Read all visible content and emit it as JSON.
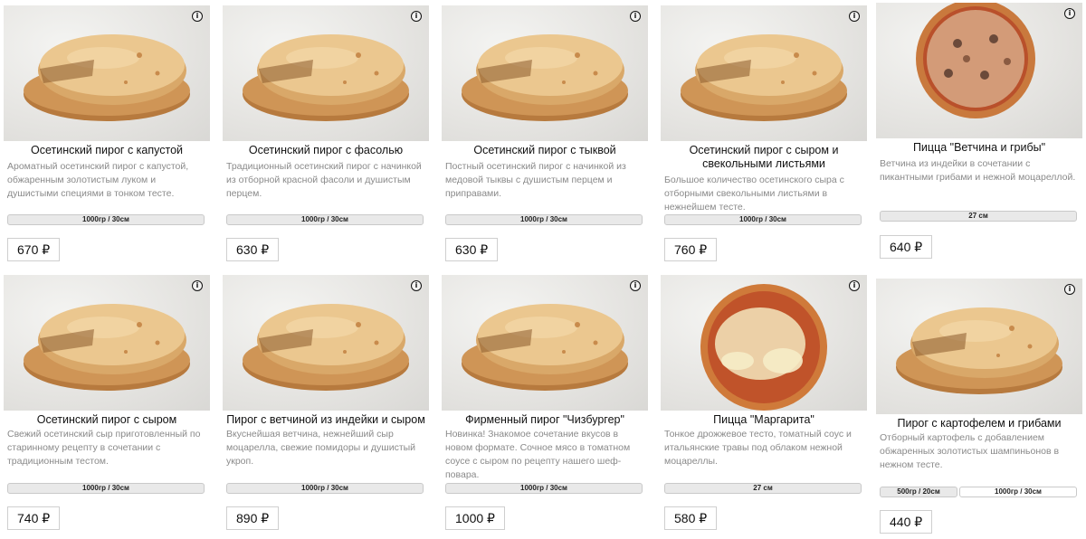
{
  "info_icon": "info-icon",
  "currency": "₽",
  "products": [
    {
      "title": "Осетинский пирог с капустой",
      "description": "Ароматный осетинский пирог с капустой, обжаренным золотистым луком и душистыми специями в тонком тесте.",
      "sizes": [
        "1000гр / 30см"
      ],
      "price": "670 ₽",
      "image": "pie-cabbage"
    },
    {
      "title": "Осетинский пирог с фасолью",
      "description": "Традиционный осетинский пирог с начинкой из отборной красной фасоли и душистым перцем.",
      "sizes": [
        "1000гр / 30см"
      ],
      "price": "630 ₽",
      "image": "pie-beans"
    },
    {
      "title": "Осетинский пирог с тыквой",
      "description": "Постный осетинский пирог с начинкой из медовой тыквы с душистым перцем и приправами.",
      "sizes": [
        "1000гр / 30см"
      ],
      "price": "630 ₽",
      "image": "pie-pumpkin"
    },
    {
      "title": "Осетинский пирог с сыром и свекольными листьями",
      "description": "Большое количество осетинского сыра с отборными свекольными листьями в нежнейшем тесте.",
      "sizes": [
        "1000гр / 30см"
      ],
      "price": "760 ₽",
      "image": "pie-cheese-beet-leaves"
    },
    {
      "title": "Пицца \"Ветчина и грибы\"",
      "description": "Ветчина из индейки в сочетании с пикантными грибами и нежной моцареллой.",
      "sizes": [
        "27 см"
      ],
      "price": "640 ₽",
      "image": "pizza-ham-mushrooms"
    },
    {
      "title": "Осетинский пирог с сыром",
      "description": "Свежий осетинский сыр приготовленный по старинному рецепту в сочетании с традиционным тестом.",
      "sizes": [
        "1000гр / 30см"
      ],
      "price": "740 ₽",
      "image": "pie-cheese"
    },
    {
      "title": "Пирог с ветчиной из индейки и сыром",
      "description": "Вкуснейшая ветчина, нежнейший сыр моцарелла, свежие помидоры и душистый укроп.",
      "sizes": [
        "1000гр / 30см"
      ],
      "price": "890 ₽",
      "image": "pie-turkey-ham-cheese"
    },
    {
      "title": "Фирменный пирог \"Чизбургер\"",
      "description": "Новинка! Знакомое сочетание вкусов в новом формате. Сочное мясо в томатном соусе с сыром по рецепту нашего шеф-повара.",
      "sizes": [
        "1000гр / 30см"
      ],
      "price": "1000 ₽",
      "image": "pie-cheeseburger"
    },
    {
      "title": "Пицца \"Маргарита\"",
      "description": "Тонкое дрожжевое тесто, томатный соус и итальянские травы под облаком нежной моцареллы.",
      "sizes": [
        "27 см"
      ],
      "price": "580 ₽",
      "image": "pizza-margherita"
    },
    {
      "title": "Пирог с картофелем и грибами",
      "description": "Отборный картофель с добавлением обжаренных золотистых шампиньонов в нежном тесте.",
      "sizes": [
        "500гр / 20см",
        "1000гр / 30см"
      ],
      "price": "440 ₽",
      "image": "pie-potato-mushrooms"
    }
  ]
}
